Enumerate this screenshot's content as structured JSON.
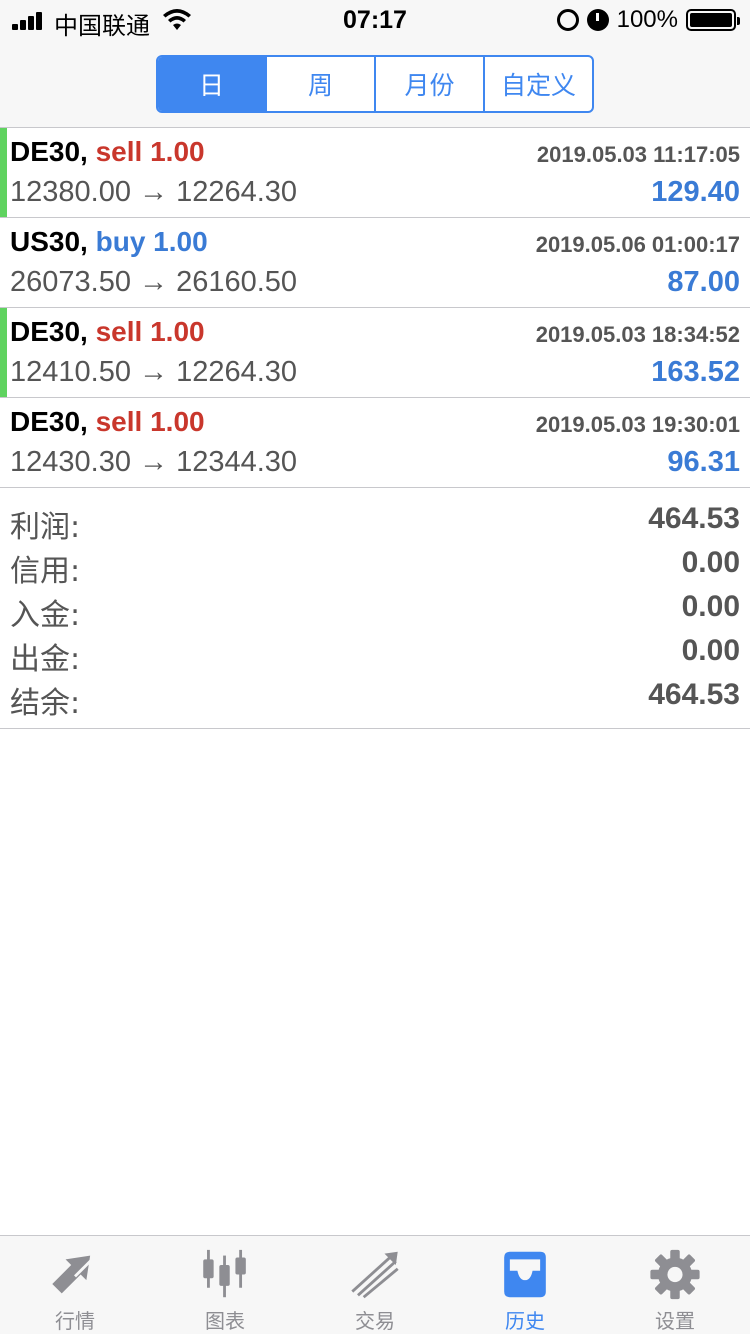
{
  "status_bar": {
    "carrier": "中国联通",
    "time": "07:17",
    "battery": "100%"
  },
  "segmented": {
    "items": [
      {
        "label": "日",
        "active": true
      },
      {
        "label": "周",
        "active": false
      },
      {
        "label": "月份",
        "active": false
      },
      {
        "label": "自定义",
        "active": false
      }
    ]
  },
  "deals": [
    {
      "symbol": "DE30,",
      "type": "sell 1.00",
      "type_kind": "sell",
      "time": "2019.05.03 11:17:05",
      "prices": "12380.00 → 12264.30",
      "profit": "129.40",
      "marker": true
    },
    {
      "symbol": "US30,",
      "type": "buy 1.00",
      "type_kind": "buy",
      "time": "2019.05.06 01:00:17",
      "prices": "26073.50 → 26160.50",
      "profit": "87.00",
      "marker": false
    },
    {
      "symbol": "DE30,",
      "type": "sell 1.00",
      "type_kind": "sell",
      "time": "2019.05.03 18:34:52",
      "prices": "12410.50 → 12264.30",
      "profit": "163.52",
      "marker": true
    },
    {
      "symbol": "DE30,",
      "type": "sell 1.00",
      "type_kind": "sell",
      "time": "2019.05.03 19:30:01",
      "prices": "12430.30 → 12344.30",
      "profit": "96.31",
      "marker": false
    }
  ],
  "summary": {
    "profit_label": "利润:",
    "profit_value": "464.53",
    "credit_label": "信用:",
    "credit_value": "0.00",
    "deposit_label": "入金:",
    "deposit_value": "0.00",
    "withdrawal_label": "出金:",
    "withdrawal_value": "0.00",
    "balance_label": "结余:",
    "balance_value": "464.53"
  },
  "tabs": [
    {
      "label": "行情",
      "icon": "quotes-icon",
      "active": false
    },
    {
      "label": "图表",
      "icon": "chart-icon",
      "active": false
    },
    {
      "label": "交易",
      "icon": "trade-icon",
      "active": false
    },
    {
      "label": "历史",
      "icon": "history-icon",
      "active": true
    },
    {
      "label": "设置",
      "icon": "settings-icon",
      "active": false
    }
  ],
  "colors": {
    "accent": "#3f87f0",
    "sell": "#c9372c",
    "buy": "#3a7bd5",
    "marker": "#5fd35f"
  }
}
